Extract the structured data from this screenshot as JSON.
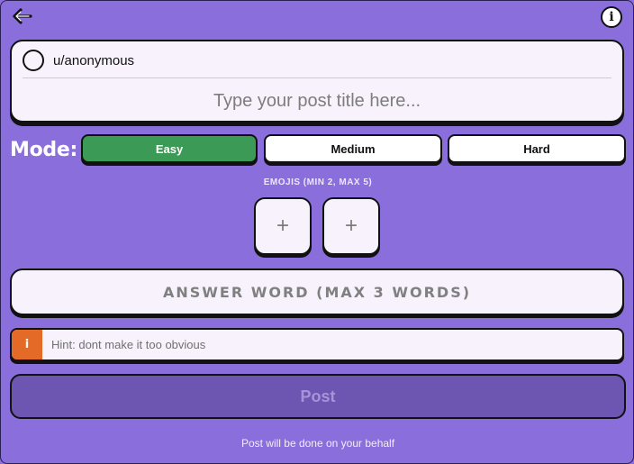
{
  "header": {
    "back_icon": "arrow-left-icon",
    "info_icon": "info-icon",
    "info_glyph": "i"
  },
  "post": {
    "username": "u/anonymous",
    "title_placeholder": "Type your post title here..."
  },
  "mode": {
    "label": "Mode:",
    "options": [
      "Easy",
      "Medium",
      "Hard"
    ],
    "selected": "Easy"
  },
  "emojis": {
    "label": "EMOJIS (MIN 2, MAX 5)",
    "slots": [
      "+",
      "+"
    ]
  },
  "answer": {
    "placeholder": "ANSWER WORD (MAX 3 WORDS)"
  },
  "hint": {
    "icon_glyph": "i",
    "placeholder": "Hint: dont make it too obvious"
  },
  "actions": {
    "post_label": "Post"
  },
  "footer": {
    "note": "Post will be done on your behalf"
  },
  "colors": {
    "background": "#8a6fdc",
    "selected_mode": "#3b9a55",
    "hint_accent": "#e46a27",
    "post_button": "#6c56b1"
  }
}
